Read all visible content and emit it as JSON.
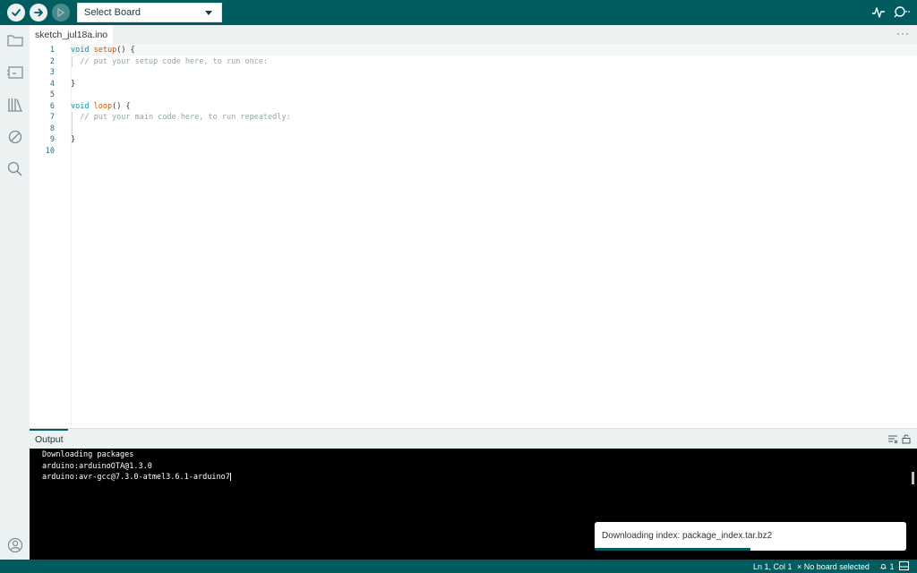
{
  "toolbar": {
    "board_select_label": "Select Board",
    "icons": [
      "verify-icon",
      "upload-icon",
      "debug-icon",
      "serial-plotter-icon",
      "serial-monitor-icon"
    ]
  },
  "sidebar": {
    "icons": [
      "folder-icon",
      "boards-manager-icon",
      "library-icon",
      "debug-disabled-icon",
      "search-icon",
      "account-icon"
    ]
  },
  "tabs": [
    {
      "label": "sketch_jul18a.ino",
      "active": true
    }
  ],
  "tabbar_more": "···",
  "editor": {
    "line_numbers": [
      "1",
      "2",
      "3",
      "4",
      "5",
      "6",
      "7",
      "8",
      "9",
      "10"
    ],
    "lines": [
      {
        "kw": "void",
        "fn": "setup",
        "rest": "() {"
      },
      {
        "comment": "  // put your setup code here, to run once:"
      },
      {
        "text": ""
      },
      {
        "text": "}"
      },
      {
        "text": ""
      },
      {
        "kw": "void",
        "fn": "loop",
        "rest": "() {"
      },
      {
        "comment": "  // put your main code here, to run repeatedly:"
      },
      {
        "text": ""
      },
      {
        "text": "}"
      },
      {
        "text": ""
      }
    ]
  },
  "output": {
    "title": "Output",
    "lines": [
      "Downloading packages",
      "arduino:arduinoOTA@1.3.0",
      "arduino:avr-gcc@7.3.0-atmel3.6.1-arduino7"
    ]
  },
  "notification": {
    "text": "Downloading index: package_index.tar.bz2",
    "progress": 0.5
  },
  "statusbar": {
    "position": "Ln 1, Col 1",
    "board_status": "No board selected",
    "notifications_count": "1"
  },
  "colors": {
    "accent": "#005c5f",
    "keyword": "#00979c",
    "function": "#d35400",
    "comment": "#95a5a6"
  }
}
